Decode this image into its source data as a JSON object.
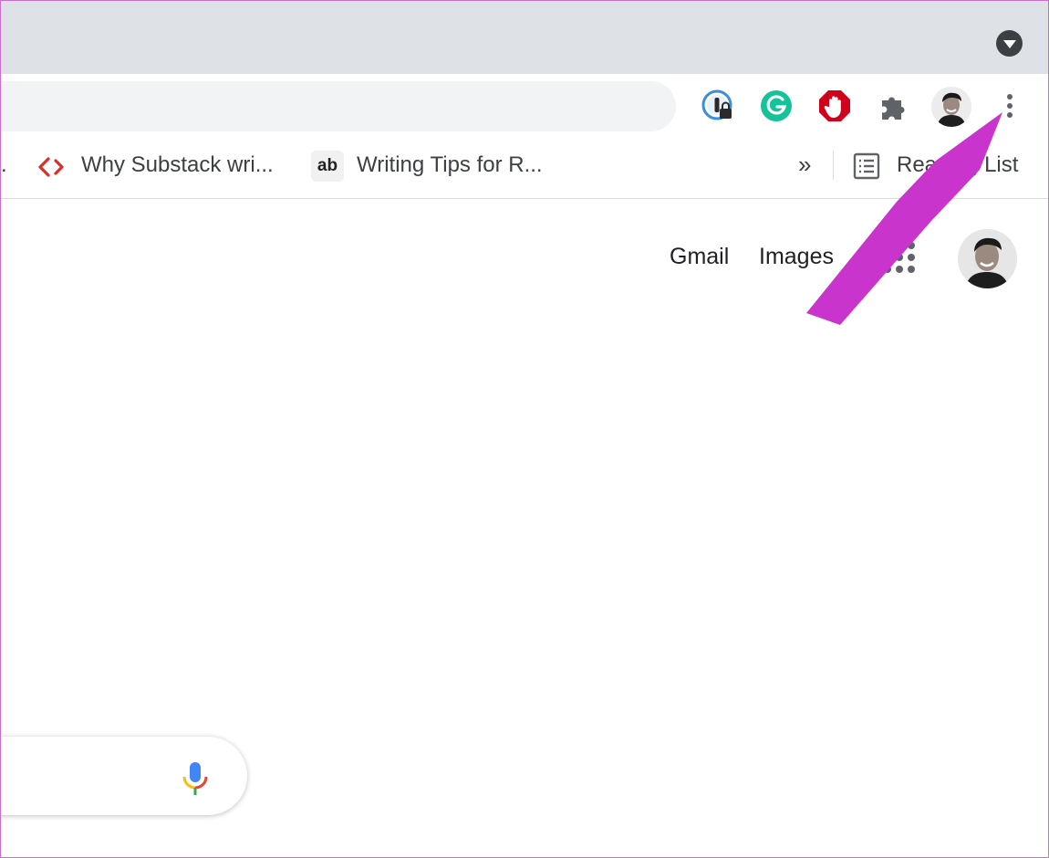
{
  "tabstrip": {
    "tab_search_icon": "tab-search-icon"
  },
  "toolbar": {
    "extensions": [
      {
        "name": "1password-icon"
      },
      {
        "name": "grammarly-icon",
        "letter": "G",
        "color": "#15c39a"
      },
      {
        "name": "adblock-icon",
        "color": "#d0021b"
      },
      {
        "name": "extensions-puzzle-icon"
      }
    ],
    "menu_icon": "kebab-menu-icon"
  },
  "bookmarks": {
    "items": [
      {
        "label": ".",
        "icon": ""
      },
      {
        "label": "Why Substack wri...",
        "icon": "code-brackets-icon",
        "icon_color": "#d93025"
      },
      {
        "label": "Writing Tips for R...",
        "icon": "ab-icon",
        "icon_text": "ab"
      }
    ],
    "overflow_label": "»",
    "reading_list_label": "Reading List"
  },
  "page": {
    "links": [
      "Gmail",
      "Images"
    ],
    "apps_icon": "google-apps-icon"
  },
  "searchbox": {
    "mic_icon": "voice-search-icon"
  },
  "annotation": {
    "arrow_color": "#c935cc"
  }
}
